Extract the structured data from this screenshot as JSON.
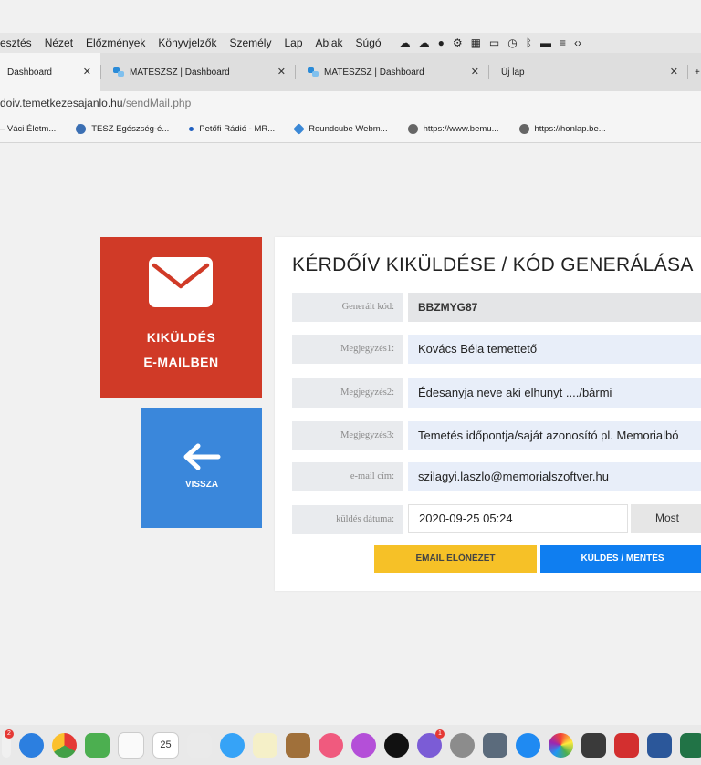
{
  "menubar": {
    "items": [
      "esztés",
      "Nézet",
      "Előzmények",
      "Könyvjelzők",
      "Személy",
      "Lap",
      "Ablak",
      "Súgó"
    ]
  },
  "tabs": [
    {
      "label": "Dashboard",
      "active": true
    },
    {
      "label": "MATESZSZ | Dashboard",
      "active": false
    },
    {
      "label": "MATESZSZ | Dashboard",
      "active": false
    },
    {
      "label": "Új lap",
      "active": false
    }
  ],
  "address": {
    "host": "doiv.temetkezesajanlo.hu",
    "path": "/sendMail.php"
  },
  "bookmarks": [
    "– Váci Életm...",
    "TESZ Egészség-é...",
    "Petőfi Rádió - MR...",
    "Roundcube Webm...",
    "https://www.bemu...",
    "https://honlap.be..."
  ],
  "tiles": {
    "send": {
      "line1": "KIKÜLDÉS",
      "line2": "E-MAILBEN",
      "color": "#d03a27"
    },
    "back": {
      "label": "VISSZA",
      "color": "#3a87db"
    }
  },
  "form": {
    "title": "KÉRDŐÍV KIKÜLDÉSE / KÓD GENERÁLÁSA",
    "rows": [
      {
        "label": "Generált kód:",
        "value": "BBZMYG87"
      },
      {
        "label": "Megjegyzés1:",
        "value": "Kovács Béla temettető"
      },
      {
        "label": "Megjegyzés2:",
        "value": "Édesanyja neve aki elhunyt ..../bármi"
      },
      {
        "label": "Megjegyzés3:",
        "value": "Temetés időpontja/saját azonosító pl. Memorialbó"
      },
      {
        "label": "e-mail cím:",
        "value": "szilagyi.laszlo@memorialszoftver.hu"
      },
      {
        "label": "küldés dátuma:",
        "value": "2020-09-25 05:24"
      }
    ],
    "now_button": "Most",
    "preview_button": "EMAIL ELŐNÉZET",
    "send_button": "KÜLDÉS / MENTÉS",
    "preview_color": "#f6c127",
    "send_color": "#0f7ef0"
  },
  "dock": {
    "calendar_day": "25"
  }
}
